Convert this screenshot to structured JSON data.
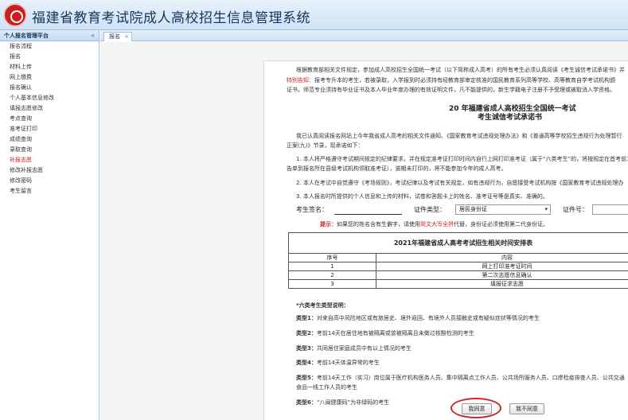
{
  "app": {
    "title": "福建省教育考试院成人高校招生信息管理系统"
  },
  "sidebar": {
    "title": "个人报名管理平台",
    "collapse": "«",
    "items": [
      {
        "label": "报名流程"
      },
      {
        "label": "报名"
      },
      {
        "label": "材料上传"
      },
      {
        "label": "网上缴费"
      },
      {
        "label": "报名确认"
      },
      {
        "label": "个人基本信息修改"
      },
      {
        "label": "填报志愿修改"
      },
      {
        "label": "考点查询"
      },
      {
        "label": "准考证打印"
      },
      {
        "label": "成绩查询"
      },
      {
        "label": "录取查询"
      },
      {
        "label": "补报志愿"
      },
      {
        "label": "修改补报志愿"
      },
      {
        "label": "修改密码"
      },
      {
        "label": "考生留言"
      }
    ]
  },
  "tabs": [
    {
      "label": "报名",
      "close": "×"
    }
  ],
  "doc": {
    "intro1": "根据教育部相关文件规定，参加成人高校招生全国统一考试（以下简称成人高考）的所有考生必须认真阅读《考生诚信考试承诺书》并",
    "special_label": "特别告知：",
    "special_text": "报考专升本的考生，若被录取，入学报到时必须持有经教育部审定核准的国民教育系列高等学校、高等教育自学考试机构颁",
    "intro2": "证书，师范专业须持有毕业证书及本人毕业年度办理的有效证明文件，凡不能提供的，新生学籍电子注册不予受理或被取消入学资格。",
    "pledge_title_1": "20  年福建省成人高校招生全国统一考试",
    "pledge_title_2": "考生诚信考试承诺书",
    "pledge_p1": "我已认真阅读报名网站上今年我省成人高考的相关文件通知、《国家教育考试违规处理办法》和《普通高等学校招生违规行为处理暂行",
    "pledge_p1b": "正案(九)》节录，现承诺如下：",
    "pledge_item1": "1. 本人将严格遵守考试期间规定的纪律要求，并在规定准考证打印时间内自行上网打印准考证（属于“六类考生”的，将按规定在首考前1",
    "pledge_item1b": "告单到报名所在县级考试机构领取准考证），逾期未打印的，将不能参加今年的成人高考。",
    "pledge_item2": "2. 本人在考试中自觉遵守《考场规则》，考试纪律以及考试有关规定，如有违规行为，自愿接受考试机构按《国家教育考试违规处理办",
    "pledge_item3": "3. 本人报名时所提供的个人信息和上传的材料，试卷和答题卡上的姓名、准考证号等是真实、准确的。",
    "signature_label": "考生签名：",
    "id_type_label": "证件类型：",
    "id_type_value": "居民身份证",
    "id_type_chevron": "▾",
    "id_no_label": "证件号：",
    "tip_label": "提示：",
    "tip_text_1": "如果您的姓名含有生僻字，请使用",
    "tip_link": "简文大写全拼",
    "tip_text_2": "代替，身份证必须使用第二代身份证。",
    "schedule": {
      "caption": "2021年福建省成人高考考试招生相关时间安排表",
      "headers": [
        "序号",
        "内容"
      ],
      "rows": [
        [
          "1",
          "网上打印准考证时间"
        ],
        [
          "2",
          "第二次志愿信息确认"
        ],
        [
          "3",
          "填报征求志愿"
        ]
      ]
    },
    "six_title": "*六类考生类型说明：",
    "six_items": [
      {
        "label": "类型1：",
        "text": "对来自高中风险地区或有旅居史、境外返回、有境外人员接触史或有疑似症状等情况的考生"
      },
      {
        "label": "类型2：",
        "text": "考前14天在居住地有被隔离或曾被隔离且未做过核酸检测的考生"
      },
      {
        "label": "类型3：",
        "text": "共同居住家庭成员中有以上情况的考生"
      },
      {
        "label": "类型4：",
        "text": "考前14天体温异常的考生"
      },
      {
        "label": "类型5：",
        "text": "考前14天工作（实习）岗位属于医疗机构医务人员、集中隔离点工作人员、公共场所服务人员、口岸检疫排查人员、公共交通"
      },
      {
        "label": "",
        "text": "食品一线工作人员的考生"
      },
      {
        "label": "类型6：",
        "text": "“八闽健康码”为非绿码的考生"
      }
    ]
  },
  "buttons": {
    "agree": "我同意",
    "disagree": "我不同意"
  }
}
